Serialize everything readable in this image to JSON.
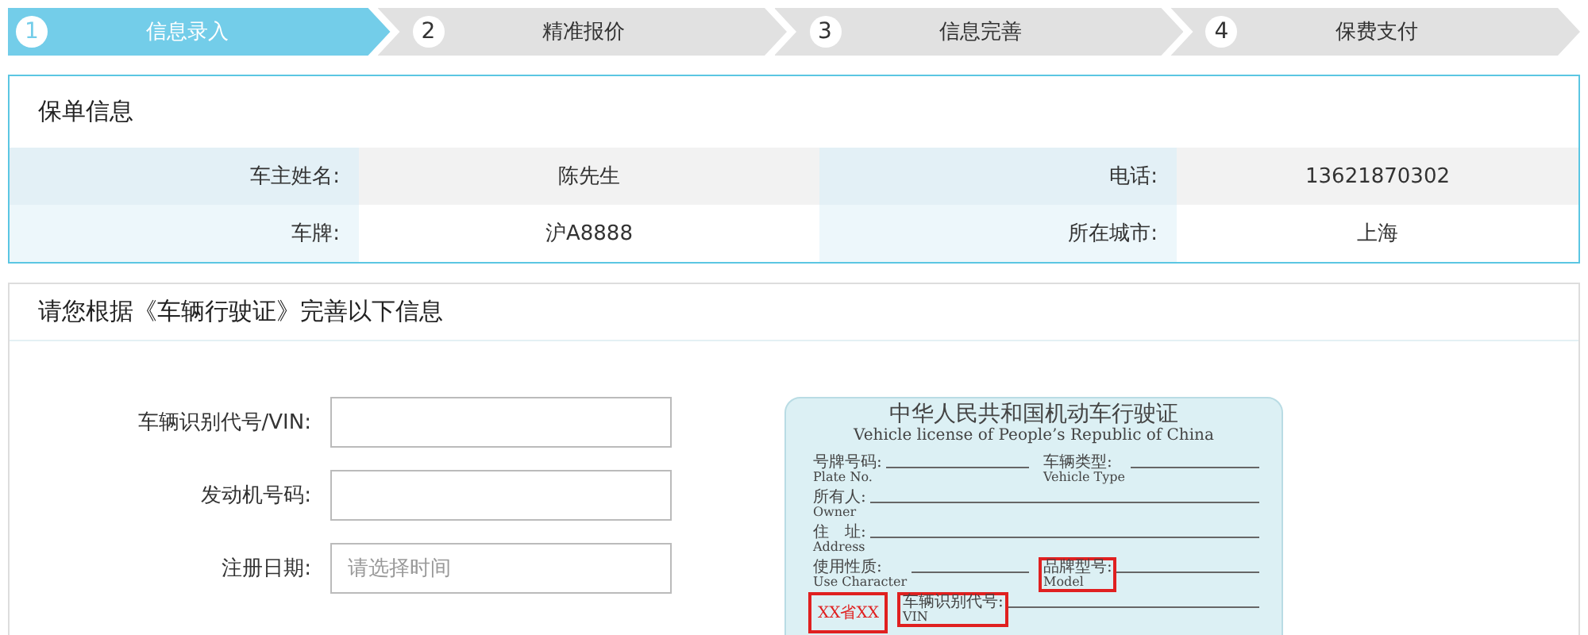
{
  "steps": [
    {
      "number": "1",
      "label": "信息录入",
      "selected": true
    },
    {
      "number": "2",
      "label": "精准报价",
      "selected": false
    },
    {
      "number": "3",
      "label": "信息完善",
      "selected": false
    },
    {
      "number": "4",
      "label": "保费支付",
      "selected": false
    }
  ],
  "policy": {
    "title": "保单信息",
    "rows": [
      [
        {
          "label": "车主姓名:",
          "value": "陈先生"
        },
        {
          "label": "电话:",
          "value": "13621870302"
        }
      ],
      [
        {
          "label": "车牌:",
          "value": "沪A8888"
        },
        {
          "label": "所在城市:",
          "value": "上海"
        }
      ]
    ]
  },
  "form": {
    "title": "请您根据《车辆行驶证》完善以下信息",
    "fields": [
      {
        "label": "车辆识别代号/VIN:",
        "kind": "text"
      },
      {
        "label": "发动机号码:",
        "kind": "text"
      },
      {
        "label": "注册日期:",
        "kind": "date",
        "placeholder": "请选择时间"
      }
    ]
  },
  "license": {
    "title": "中华人民共和国机动车行驶证",
    "subtitle": "Vehicle license of People’s Republic of China",
    "rows": [
      [
        {
          "label": "号牌号码:",
          "label_en": "Plate No.",
          "highlighted": false
        },
        {
          "label": "车辆类型:",
          "label_en": "Vehicle Type",
          "highlighted": false
        }
      ],
      [
        {
          "label": "所有人:",
          "label_en": "Owner",
          "highlighted": false
        }
      ],
      [
        {
          "label": "住　址:",
          "label_en": "Address",
          "highlighted": false
        }
      ],
      [
        {
          "label": "使用性质:",
          "label_en": "Use Character",
          "highlighted": false
        },
        {
          "label": "品牌型号:",
          "label_en": "Model",
          "highlighted": true
        }
      ]
    ],
    "stamp": "XX省XX",
    "last_field": {
      "label": "车辆识别代号:",
      "label_en": "VIN",
      "highlighted": true
    }
  }
}
